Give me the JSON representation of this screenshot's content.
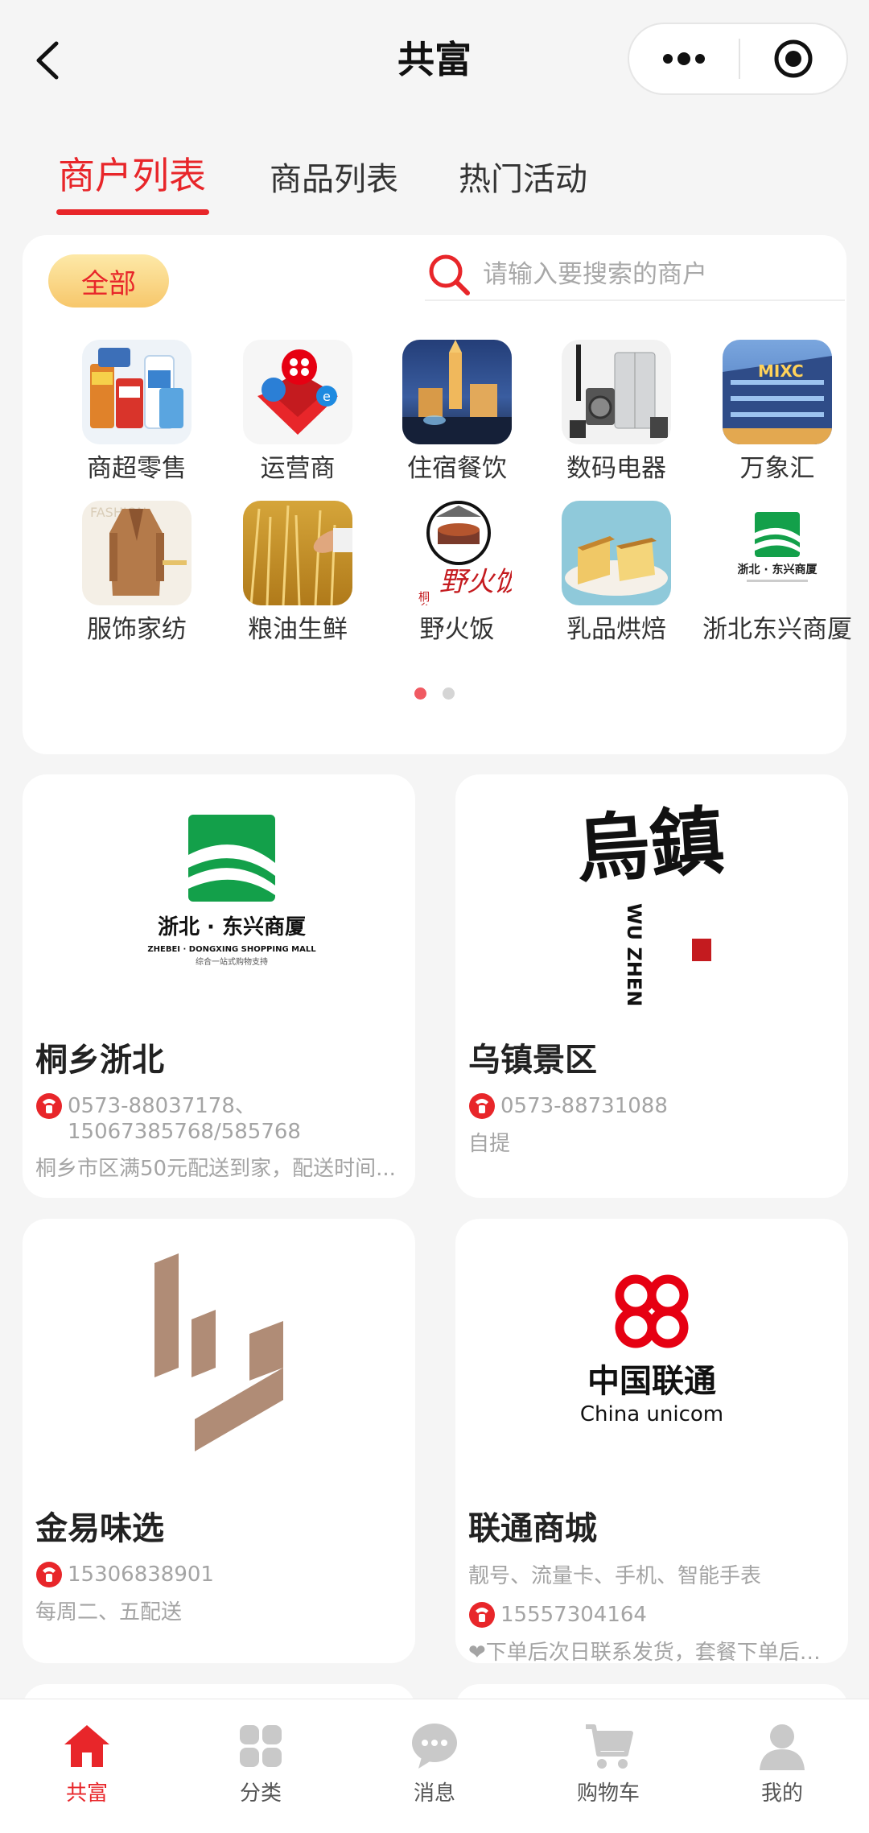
{
  "header": {
    "title": "共富"
  },
  "tabs": [
    {
      "label": "商户列表",
      "active": true
    },
    {
      "label": "商品列表",
      "active": false
    },
    {
      "label": "热门活动",
      "active": false
    }
  ],
  "filter": {
    "all_label": "全部",
    "search_placeholder": "请输入要搜索的商户"
  },
  "categories": [
    {
      "label": "商超零售",
      "icon": "retail-goods-icon"
    },
    {
      "label": "运营商",
      "icon": "telecom-gift-icon"
    },
    {
      "label": "住宿餐饮",
      "icon": "hotel-night-icon"
    },
    {
      "label": "数码电器",
      "icon": "appliances-icon"
    },
    {
      "label": "万象汇",
      "icon": "mall-building-icon"
    },
    {
      "label": "服饰家纺",
      "icon": "coat-icon"
    },
    {
      "label": "粮油生鲜",
      "icon": "wheat-icon"
    },
    {
      "label": "野火饭",
      "icon": "wildfire-rice-logo",
      "logo_text": "野火饭"
    },
    {
      "label": "乳品烘焙",
      "icon": "cake-icon"
    },
    {
      "label": "浙北东兴商厦",
      "icon": "zhebei-logo",
      "logo_text": "浙北 · 东兴商厦"
    }
  ],
  "pager": {
    "count": 2,
    "active": 0
  },
  "merchants": [
    {
      "name": "桐乡浙北",
      "logo": {
        "title": "浙北 · 东兴商厦",
        "subtitle": "ZHEBEI · DONGXING SHOPPING MALL",
        "tagline": "综合一站式购物支持"
      },
      "phone": "0573-88037178、15067385768/585768",
      "desc": "桐乡市区满50元配送到家，配送时间..."
    },
    {
      "name": "乌镇景区",
      "logo": {
        "title": "烏鎮",
        "subtitle": "WU ZHEN"
      },
      "phone": "0573-88731088",
      "desc": "自提"
    },
    {
      "name": "金易味选",
      "logo": {},
      "phone": "15306838901",
      "desc": "每周二、五配送"
    },
    {
      "name": "联通商城",
      "logo": {
        "title": "中国联通",
        "subtitle": "China unicom"
      },
      "tags": "靓号、流量卡、手机、智能手表",
      "phone": "15557304164",
      "desc": "❤下单后次日联系发货，套餐下单后可..."
    }
  ],
  "bottom_nav": [
    {
      "label": "共富",
      "icon": "home-icon",
      "active": true
    },
    {
      "label": "分类",
      "icon": "category-icon",
      "active": false
    },
    {
      "label": "消息",
      "icon": "message-icon",
      "active": false
    },
    {
      "label": "购物车",
      "icon": "cart-icon",
      "active": false
    },
    {
      "label": "我的",
      "icon": "profile-icon",
      "active": false
    }
  ],
  "colors": {
    "accent": "#e8262a",
    "pill": "#f7c76b",
    "unicom": "#e60012",
    "zhebei": "#13a04a"
  }
}
